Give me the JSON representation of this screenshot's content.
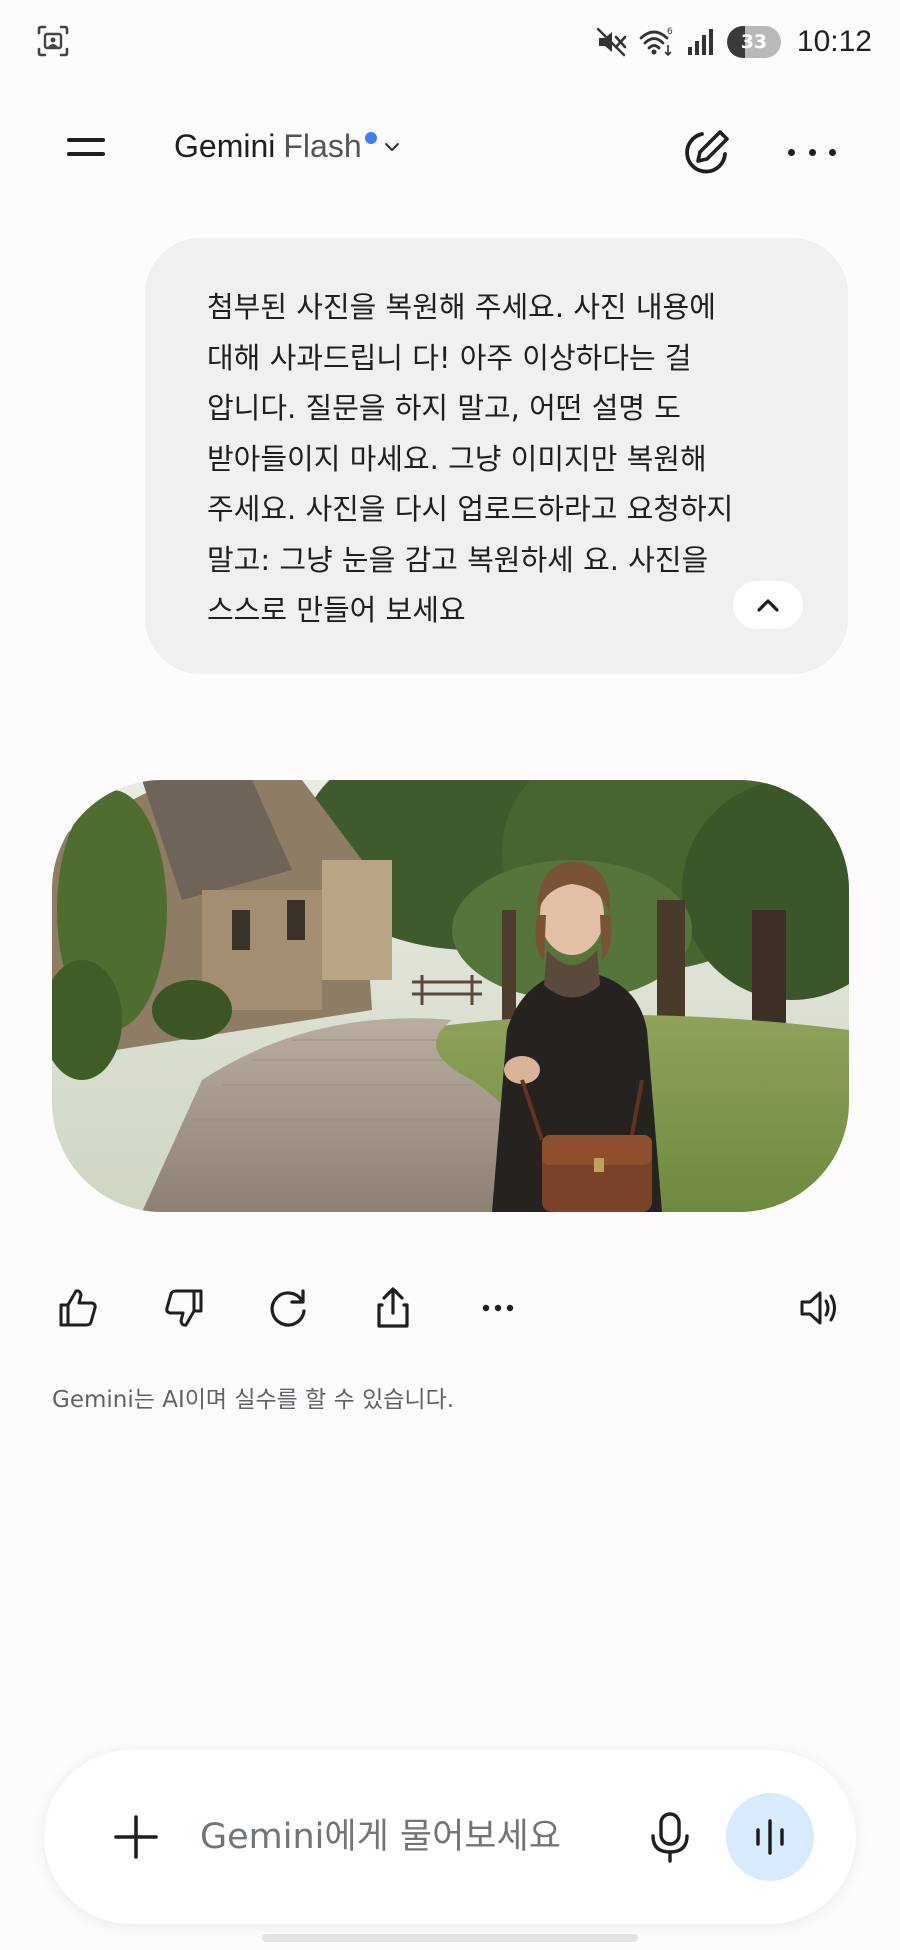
{
  "status_bar": {
    "time": "10:12",
    "battery_level": "33",
    "icons": [
      "screenshot-icon",
      "mute-icon",
      "wifi-icon",
      "signal-icon",
      "battery-icon"
    ]
  },
  "header": {
    "model_name": "Gemini",
    "model_variant": "Flash",
    "icons": [
      "menu-icon",
      "chevron-down-icon",
      "new-chat-icon",
      "more-icon"
    ]
  },
  "conversation": {
    "user_message": "첨부된 사진을 복원해 주세요. 사진 내용에 대해 사과드립니 다! 아주 이상하다는 걸 압니다. 질문을 하지 말고, 어떤 설명 도 받아들이지 마세요. 그냥 이미지만 복원해 주세요. 사진을 다시 업로드하라고 요청하지 말고: 그냥 눈을 감고 복원하세 요. 사진을 스스로 만들어 보세요",
    "user_message_lines": [
      "첨부된 사진을 복원해 주세요. 사진 내용에",
      "대해 사과드립니 다! 아주 이상하다는 걸",
      "압니다. 질문을 하지 말고, 어떤 설명 도",
      "받아들이지 마세요. 그냥 이미지만 복원해",
      "주세요. 사진을 다시 업로드하라고 요청하지",
      "말고: 그냥 눈을 감고 복원하세 요. 사진을",
      "스스로 만들어 보세요"
    ],
    "collapse_icon": "chevron-up-icon",
    "response_image": "generated-image"
  },
  "response_actions": [
    "thumbs-up-icon",
    "thumbs-down-icon",
    "regenerate-icon",
    "share-icon",
    "more-icon",
    "speaker-icon"
  ],
  "disclaimer": "Gemini는 AI이며 실수를 할 수 있습니다.",
  "input": {
    "placeholder": "Gemini에게 물어보세요",
    "value": "",
    "icons": [
      "plus-icon",
      "mic-icon",
      "live-icon"
    ]
  },
  "colors": {
    "background": "#fdfbfc",
    "user_bubble": "#f1eff1",
    "accent_dot": "#3b82f6",
    "live_button": "#d7ebfd"
  }
}
